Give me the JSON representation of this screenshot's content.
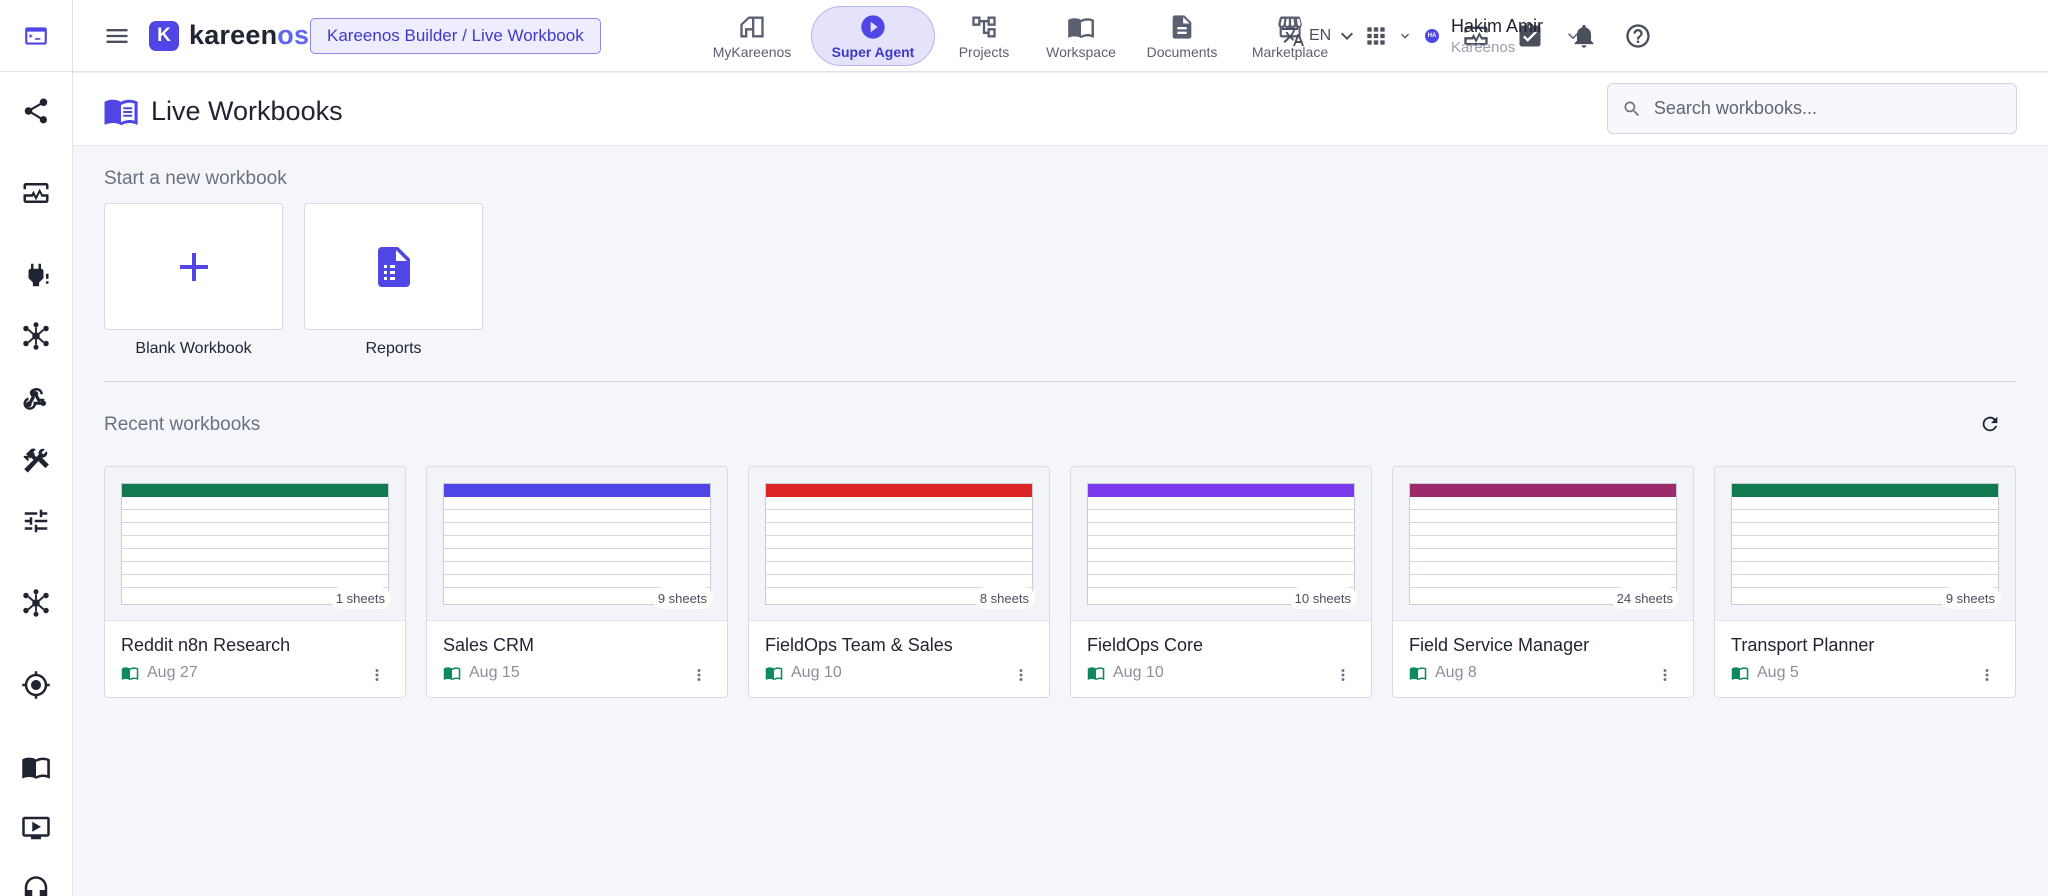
{
  "app": {
    "logo_letter": "K",
    "name_main": "kareen",
    "name_accent": "os",
    "breadcrumb": "Kareenos Builder / Live Workbook",
    "accent_color": "#4f46e5"
  },
  "nav": [
    {
      "label": "MyKareenos",
      "icon": "home-icon"
    },
    {
      "label": "Super Agent",
      "icon": "play-circle-icon",
      "active": true
    },
    {
      "label": "Projects",
      "icon": "hierarchy-icon"
    },
    {
      "label": "Workspace",
      "icon": "open-book-icon"
    },
    {
      "label": "Documents",
      "icon": "document-icon"
    },
    {
      "label": "Marketplace",
      "icon": "storefront-icon"
    }
  ],
  "header": {
    "language": "EN",
    "user_initials": "HA",
    "user_name": "Hakim Amir",
    "user_org": "Kareenos"
  },
  "page": {
    "title": "Live Workbooks",
    "search_placeholder": "Search workbooks..."
  },
  "new_section": {
    "title": "Start a new workbook",
    "templates": [
      {
        "label": "Blank Workbook",
        "icon": "plus-icon"
      },
      {
        "label": "Reports",
        "icon": "report-document-icon"
      }
    ]
  },
  "recent_section": {
    "title": "Recent workbooks",
    "workbooks": [
      {
        "name": "Reddit n8n Research",
        "date": "Aug 27",
        "sheets": "1 sheets",
        "color": "#0f7a50"
      },
      {
        "name": "Sales CRM",
        "date": "Aug 15",
        "sheets": "9 sheets",
        "color": "#4f46e5"
      },
      {
        "name": "FieldOps Team & Sales",
        "date": "Aug 10",
        "sheets": "8 sheets",
        "color": "#dc2626"
      },
      {
        "name": "FieldOps Core",
        "date": "Aug 10",
        "sheets": "10 sheets",
        "color": "#7c3aed"
      },
      {
        "name": "Field Service Manager",
        "date": "Aug 8",
        "sheets": "24 sheets",
        "color": "#9d2a6a"
      },
      {
        "name": "Transport Planner",
        "date": "Aug 5",
        "sheets": "9 sheets",
        "color": "#0f7a50"
      }
    ]
  }
}
